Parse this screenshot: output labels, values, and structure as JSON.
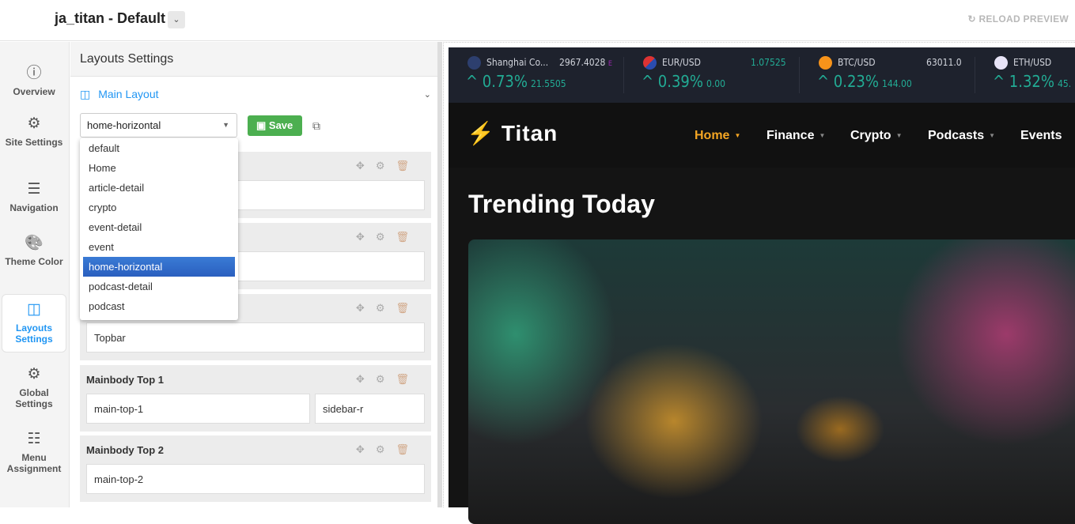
{
  "header": {
    "title": "ja_titan - Default",
    "reload_label": "RELOAD PREVIEW"
  },
  "sidebar": {
    "items": [
      {
        "label": "Overview",
        "icon": "info-icon",
        "glyph": "ⓘ"
      },
      {
        "label": "Site Settings",
        "icon": "gear-icon",
        "glyph": "⚙"
      },
      {
        "label": "Navigation",
        "icon": "menu-icon",
        "glyph": "☰"
      },
      {
        "label": "Theme Color",
        "icon": "palette-icon",
        "glyph": "🎨"
      },
      {
        "label": "Layouts Settings",
        "icon": "columns-icon",
        "glyph": "◫"
      },
      {
        "label": "Global Settings",
        "icon": "gears-icon",
        "glyph": "⚙"
      },
      {
        "label": "Menu Assignment",
        "icon": "checklist-icon",
        "glyph": "☷"
      }
    ],
    "active": "Layouts Settings"
  },
  "panel": {
    "title": "Layouts Settings",
    "section": "Main Layout",
    "selected_layout": "home-horizontal",
    "save_label": "Save",
    "options": [
      "default",
      "Home",
      "article-detail",
      "crypto",
      "event-detail",
      "event",
      "home-horizontal",
      "podcast-detail",
      "podcast"
    ],
    "blocks": [
      {
        "title": "",
        "positions": [
          ""
        ]
      },
      {
        "title": "",
        "positions": [
          ""
        ]
      },
      {
        "title": "",
        "positions": [
          "Topbar"
        ]
      },
      {
        "title": "Mainbody Top 1",
        "positions": [
          "main-top-1",
          "sidebar-r"
        ]
      },
      {
        "title": "Mainbody Top 2",
        "positions": [
          "main-top-2"
        ]
      }
    ]
  },
  "preview": {
    "ticker": [
      {
        "name": "Shanghai Co...",
        "price": "2967.4028",
        "suffix": "E",
        "change": "0.73%",
        "delta": "21.5505"
      },
      {
        "name": "EUR/USD",
        "price": "1.07525",
        "change": "0.39%",
        "delta": "0.00"
      },
      {
        "name": "BTC/USD",
        "price": "63011.0",
        "change": "0.23%",
        "delta": "144.00"
      },
      {
        "name": "ETH/USD",
        "price": "",
        "change": "1.32%",
        "delta": "45."
      }
    ],
    "logo": "Titan",
    "menu": [
      "Home",
      "Finance",
      "Crypto",
      "Podcasts",
      "Events"
    ],
    "heading": "Trending Today",
    "colors": {
      "accent": "#2196f3",
      "save": "#4caf50",
      "brand": "#f5a623",
      "up": "#22ab94"
    }
  }
}
